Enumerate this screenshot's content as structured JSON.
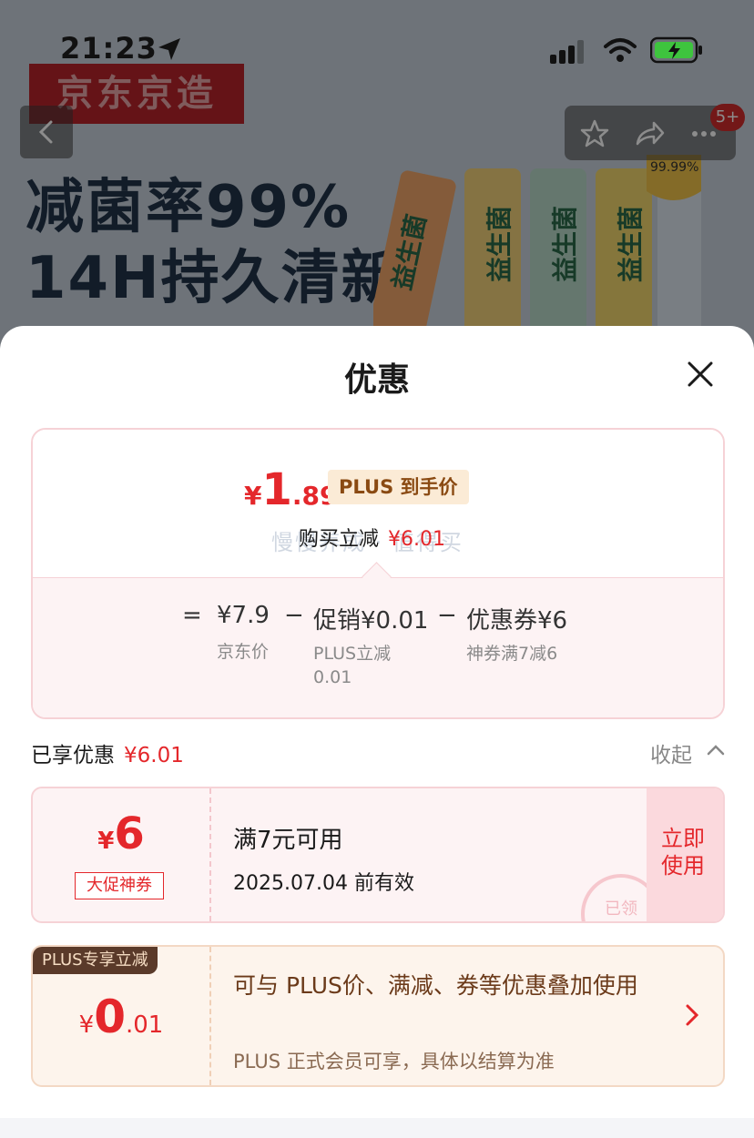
{
  "status_bar": {
    "time": "21:23"
  },
  "background_page": {
    "brand_banner": "京东京造",
    "headline_line1": "减菌率99%",
    "headline_line2": "14H持久清新",
    "message_badge": "5+",
    "product_text": "益生菌",
    "shield_text": "99.99%"
  },
  "sheet": {
    "title": "优惠",
    "price_summary": {
      "final_price_currency": "¥",
      "final_price_int": "1",
      "final_price_dec": ".89",
      "plus_tag": "PLUS 到手价",
      "buy_reduce_label": "购买立减",
      "buy_reduce_amount": "¥6.01",
      "watermark": "慢慢养成 · 值得买"
    },
    "breakdown": {
      "equals": "=",
      "jd_price": "¥7.9",
      "jd_price_label": "京东价",
      "minus1": "−",
      "promo": "促销¥0.01",
      "promo_label_line1": "PLUS立减",
      "promo_label_line2": "0.01",
      "minus2": "−",
      "coupon": "优惠券¥6",
      "coupon_label": "神券满7减6"
    },
    "enjoyed": {
      "label": "已享优惠",
      "amount": "¥6.01",
      "collapse": "收起"
    },
    "coupon_card": {
      "currency": "¥",
      "amount": "6",
      "tag": "大促神券",
      "condition": "满7元可用",
      "validity": "2025.07.04 前有效",
      "action": "立即使用",
      "stamp": "已领"
    },
    "plus_card": {
      "ribbon": "PLUS专享立减",
      "currency": "¥",
      "amount_int": "0",
      "amount_dec": ".01",
      "description": "可与 PLUS价、满减、券等优惠叠加使用",
      "note": "PLUS 正式会员可享，具体以结算为准"
    }
  },
  "colors": {
    "accent_red": "#e4272b",
    "plus_brown": "#6b3a1a",
    "plus_tag_bg": "#fbebd6"
  }
}
